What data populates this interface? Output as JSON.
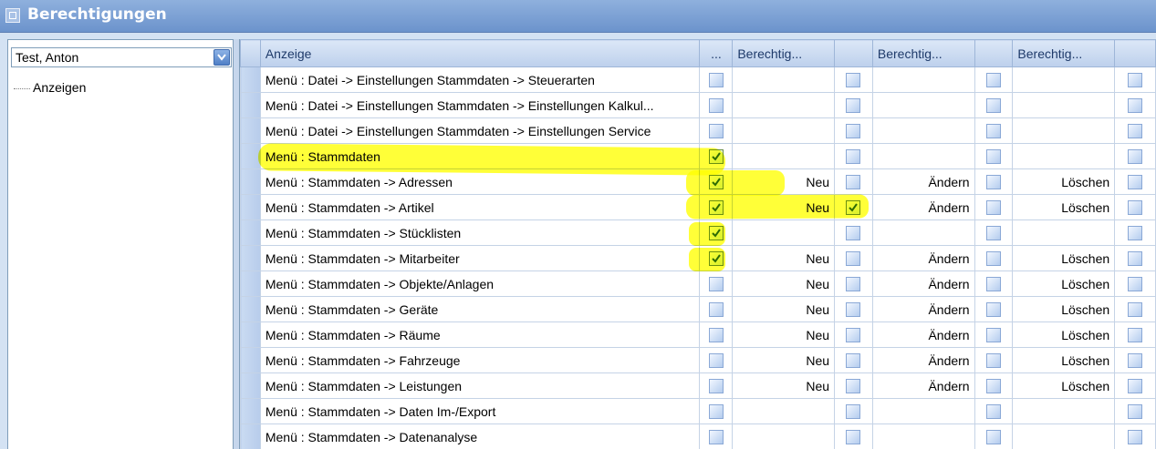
{
  "window": {
    "title": "Berechtigungen"
  },
  "user_select": {
    "value": "Test, Anton"
  },
  "tree": {
    "items": [
      "Anzeigen"
    ]
  },
  "grid": {
    "headers": {
      "col1": "Anzeige",
      "col2": "...",
      "col3": "Berechtig...",
      "col5": "Berechtig...",
      "col7": "Berechtig..."
    },
    "rows": [
      {
        "name": "Menü : Datei -> Einstellungen Stammdaten -> Steuerarten",
        "c1": false,
        "neu": "",
        "c2": false,
        "aendern": "",
        "c3": false,
        "loeschen": "",
        "c4": false
      },
      {
        "name": "Menü : Datei -> Einstellungen Stammdaten -> Einstellungen Kalkul...",
        "c1": false,
        "neu": "",
        "c2": false,
        "aendern": "",
        "c3": false,
        "loeschen": "",
        "c4": false
      },
      {
        "name": "Menü : Datei -> Einstellungen Stammdaten -> Einstellungen Service",
        "c1": false,
        "neu": "",
        "c2": false,
        "aendern": "",
        "c3": false,
        "loeschen": "",
        "c4": false
      },
      {
        "name": "Menü : Stammdaten",
        "c1": true,
        "neu": "",
        "c2": false,
        "aendern": "",
        "c3": false,
        "loeschen": "",
        "c4": false
      },
      {
        "name": "Menü : Stammdaten -> Adressen",
        "c1": true,
        "neu": "Neu",
        "c2": false,
        "aendern": "Ändern",
        "c3": false,
        "loeschen": "Löschen",
        "c4": false
      },
      {
        "name": "Menü : Stammdaten -> Artikel",
        "c1": true,
        "neu": "Neu",
        "c2": true,
        "aendern": "Ändern",
        "c3": false,
        "loeschen": "Löschen",
        "c4": false
      },
      {
        "name": "Menü : Stammdaten -> Stücklisten",
        "c1": true,
        "neu": "",
        "c2": false,
        "aendern": "",
        "c3": false,
        "loeschen": "",
        "c4": false
      },
      {
        "name": "Menü : Stammdaten -> Mitarbeiter",
        "c1": true,
        "neu": "Neu",
        "c2": false,
        "aendern": "Ändern",
        "c3": false,
        "loeschen": "Löschen",
        "c4": false
      },
      {
        "name": "Menü : Stammdaten -> Objekte/Anlagen",
        "c1": false,
        "neu": "Neu",
        "c2": false,
        "aendern": "Ändern",
        "c3": false,
        "loeschen": "Löschen",
        "c4": false
      },
      {
        "name": "Menü : Stammdaten -> Geräte",
        "c1": false,
        "neu": "Neu",
        "c2": false,
        "aendern": "Ändern",
        "c3": false,
        "loeschen": "Löschen",
        "c4": false
      },
      {
        "name": "Menü : Stammdaten -> Räume",
        "c1": false,
        "neu": "Neu",
        "c2": false,
        "aendern": "Ändern",
        "c3": false,
        "loeschen": "Löschen",
        "c4": false
      },
      {
        "name": "Menü : Stammdaten -> Fahrzeuge",
        "c1": false,
        "neu": "Neu",
        "c2": false,
        "aendern": "Ändern",
        "c3": false,
        "loeschen": "Löschen",
        "c4": false
      },
      {
        "name": "Menü : Stammdaten -> Leistungen",
        "c1": false,
        "neu": "Neu",
        "c2": false,
        "aendern": "Ändern",
        "c3": false,
        "loeschen": "Löschen",
        "c4": false
      },
      {
        "name": "Menü : Stammdaten -> Daten Im-/Export",
        "c1": false,
        "neu": "",
        "c2": false,
        "aendern": "",
        "c3": false,
        "loeschen": "",
        "c4": false
      },
      {
        "name": "Menü : Stammdaten -> Datenanalyse",
        "c1": false,
        "neu": "",
        "c2": false,
        "aendern": "",
        "c3": false,
        "loeschen": "",
        "c4": false
      }
    ]
  },
  "colors": {
    "highlight": "#ffff00",
    "titlebar": "#7a9fd4",
    "checkbox_on": "#2e6b10"
  }
}
